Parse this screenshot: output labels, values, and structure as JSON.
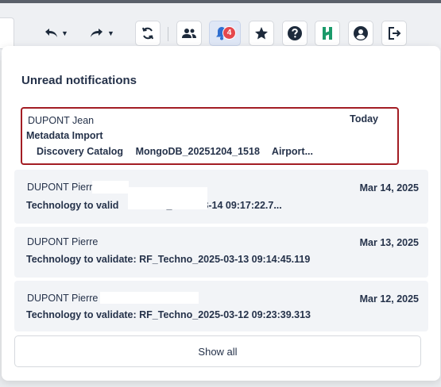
{
  "toolbar": {
    "icons": [
      "undo-icon",
      "redo-icon",
      "refresh-icon",
      "users-icon",
      "bell-icon",
      "star-icon",
      "help-icon",
      "h-logo-icon",
      "account-icon",
      "logout-icon"
    ],
    "notification_count": "4"
  },
  "panel": {
    "title": "Unread notifications",
    "notifications": [
      {
        "author": "DUPONT Jean",
        "date": "Today",
        "title": "Metadata Import",
        "crumbs": [
          "Discovery Catalog",
          "MongoDB_20251204_1518",
          "Airport..."
        ]
      },
      {
        "author": "DUPONT Pierre",
        "date": "Mar 14, 2025",
        "message": "Technology to valid                        _2025-03-14 09:17:22.7..."
      },
      {
        "author": "DUPONT Pierre",
        "date": "Mar 13, 2025",
        "message": "Technology to validate: RF_Techno_2025-03-13 09:14:45.119"
      },
      {
        "author": "DUPONT Pierre",
        "date": "Mar 12, 2025",
        "message": "Technology to validate: RF_Techno_2025-03-12 09:23:39.313"
      }
    ],
    "show_all_label": "Show all"
  }
}
